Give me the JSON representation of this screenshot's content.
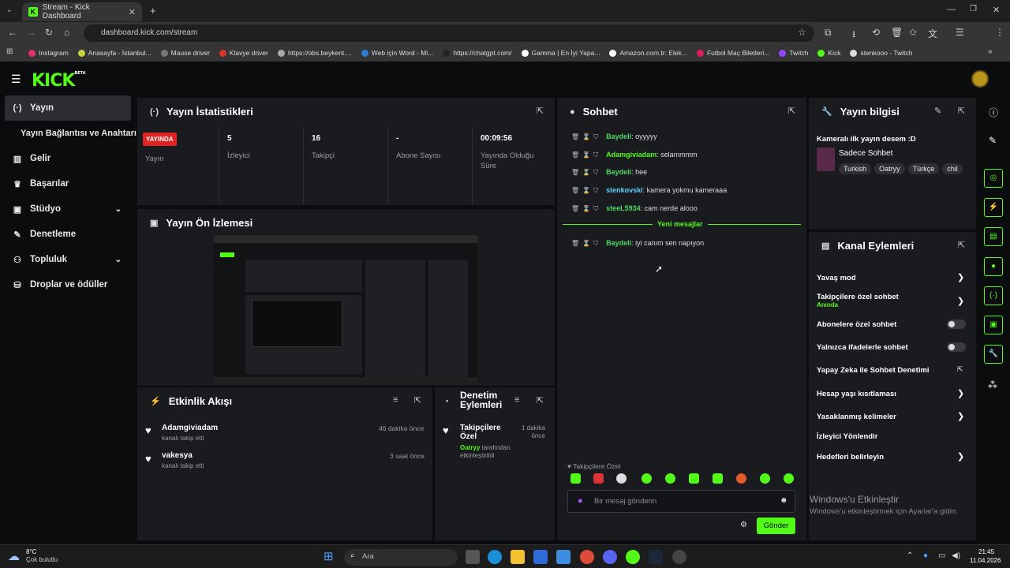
{
  "browser": {
    "tab_title": "Stream - Kick Dashboard",
    "url": "dashboard.kick.com/stream",
    "bookmarks": [
      {
        "label": "Instagram",
        "color": "#e1306c"
      },
      {
        "label": "Anasayfa - İstanbul...",
        "color": "#c7d33a"
      },
      {
        "label": "Mause driver",
        "color": "#777777"
      },
      {
        "label": "Klavye driver",
        "color": "#d9342b"
      },
      {
        "label": "https://obs.beykent....",
        "color": "#aaaaaa"
      },
      {
        "label": "Web için Word - Mi...",
        "color": "#2b7cd3"
      },
      {
        "label": "https://chatgpt.com/",
        "color": "#222222"
      },
      {
        "label": "Gamma | En İyi Yapa...",
        "color": "#ffffff"
      },
      {
        "label": "Amazon.com.tr: Elek...",
        "color": "#ffffff"
      },
      {
        "label": "Futbol Maç Biletleri...",
        "color": "#d91c5c"
      },
      {
        "label": "Twitch",
        "color": "#9146ff"
      },
      {
        "label": "Kick",
        "color": "#53fc18"
      },
      {
        "label": "stenkooo - Twitch",
        "color": "#dddddd"
      }
    ]
  },
  "kick": {
    "logo": "KICK",
    "logo_sup": "BETA"
  },
  "sidebar": {
    "items": [
      {
        "label": "Yayın",
        "icon": "broadcast-icon"
      },
      {
        "label": "Yayın Bağlantısı ve Anahtarı",
        "icon": ""
      },
      {
        "label": "Gelir",
        "icon": "chart-icon"
      },
      {
        "label": "Başarılar",
        "icon": "trophy-icon"
      },
      {
        "label": "Stüdyo",
        "icon": "studio-icon"
      },
      {
        "label": "Denetleme",
        "icon": "wrench-icon"
      },
      {
        "label": "Topluluk",
        "icon": "community-icon"
      },
      {
        "label": "Droplar ve ödüller",
        "icon": "drops-icon"
      }
    ]
  },
  "stats": {
    "title": "Yayın İstatistikleri",
    "live_badge": "YAYINDA",
    "status_label": "Yayın",
    "viewers_value": "5",
    "viewers_label": "İzleyici",
    "followers_value": "16",
    "followers_label": "Takipçi",
    "subs_value": "-",
    "subs_label": "Abone Sayısı",
    "duration_value": "00:09:56",
    "duration_label_1": "Yayında Olduğu",
    "duration_label_2": "Süre"
  },
  "preview": {
    "title": "Yayın Ön İzlemesi"
  },
  "activity": {
    "title": "Etkinlik Akışı",
    "items": [
      {
        "user": "Adamgiviadam",
        "text": "kanalı takip etti",
        "time": "46 dakika önce"
      },
      {
        "user": "vakesya",
        "text": "kanalı takip etti",
        "time": "3 saat önce"
      }
    ]
  },
  "moderation": {
    "title_1": "Denetim",
    "title_2": "Eylemleri",
    "item_title_1": "Takipçilere",
    "item_title_2": "Özel",
    "item_time_1": "1 dakika",
    "item_time_2": "önce",
    "item_user": "Oatryy",
    "item_text_1": "tarafından",
    "item_text_2": "etkinleştirildi"
  },
  "chat": {
    "title": "Sohbet",
    "messages": [
      {
        "user": "Baydeli",
        "text": ": oyyyyy"
      },
      {
        "user": "Adamgiviadam",
        "text": ": selammmm"
      },
      {
        "user": "Baydeli",
        "text": ": hee"
      },
      {
        "user": "stenkovski",
        "text": ": kamera yokmu kameraaa"
      },
      {
        "user": "steeL5934",
        "text": ": cam nerde alooo"
      }
    ],
    "new_messages": "Yeni mesajlar",
    "new_message": {
      "user": "Baydeli",
      "text": ": iyi canım sen napıyon"
    },
    "followers_only": "Takipçilere Özel",
    "input_placeholder": "Bir mesaj gönderin",
    "send": "Gönder"
  },
  "stream_info": {
    "title": "Yayın bilgisi",
    "stream_title": "Kameralı ilk yayın desem :D",
    "category": "Sadece Sohbet",
    "tags": [
      "Turkish",
      "Oatryy",
      "Türkçe",
      "chil"
    ]
  },
  "channel_actions": {
    "title": "Kanal Eylemleri",
    "slow_mode": "Yavaş mod",
    "followers_chat": "Takipçilere özel sohbet",
    "followers_chat_sub": "Anında",
    "subs_chat": "Abonelere özel sohbet",
    "emote_chat": "Yalnızca ifadelerle sohbet",
    "ai_moderation": "Yapay Zeka ile Sohbet Denetimi",
    "age_restriction": "Hesap yaşı kısıtlaması",
    "banned_words": "Yasaklanmış kelimeler",
    "redirect": "İzleyici Yönlendir",
    "goals": "Hedefleri belirleyin"
  },
  "windows": {
    "activate_1": "Windows'u Etkinleştir",
    "activate_2": "Windows'u etkinleştirmek için Ayarlar'a gidin.",
    "weather_temp": "8°C",
    "weather_desc": "Çok bulutlu",
    "search": "Ara",
    "time": "21:45",
    "date": "11.04.2026"
  },
  "colors": {
    "kick_green": "#53fc18",
    "panel": "#191b1f",
    "live_red": "#e02424"
  }
}
